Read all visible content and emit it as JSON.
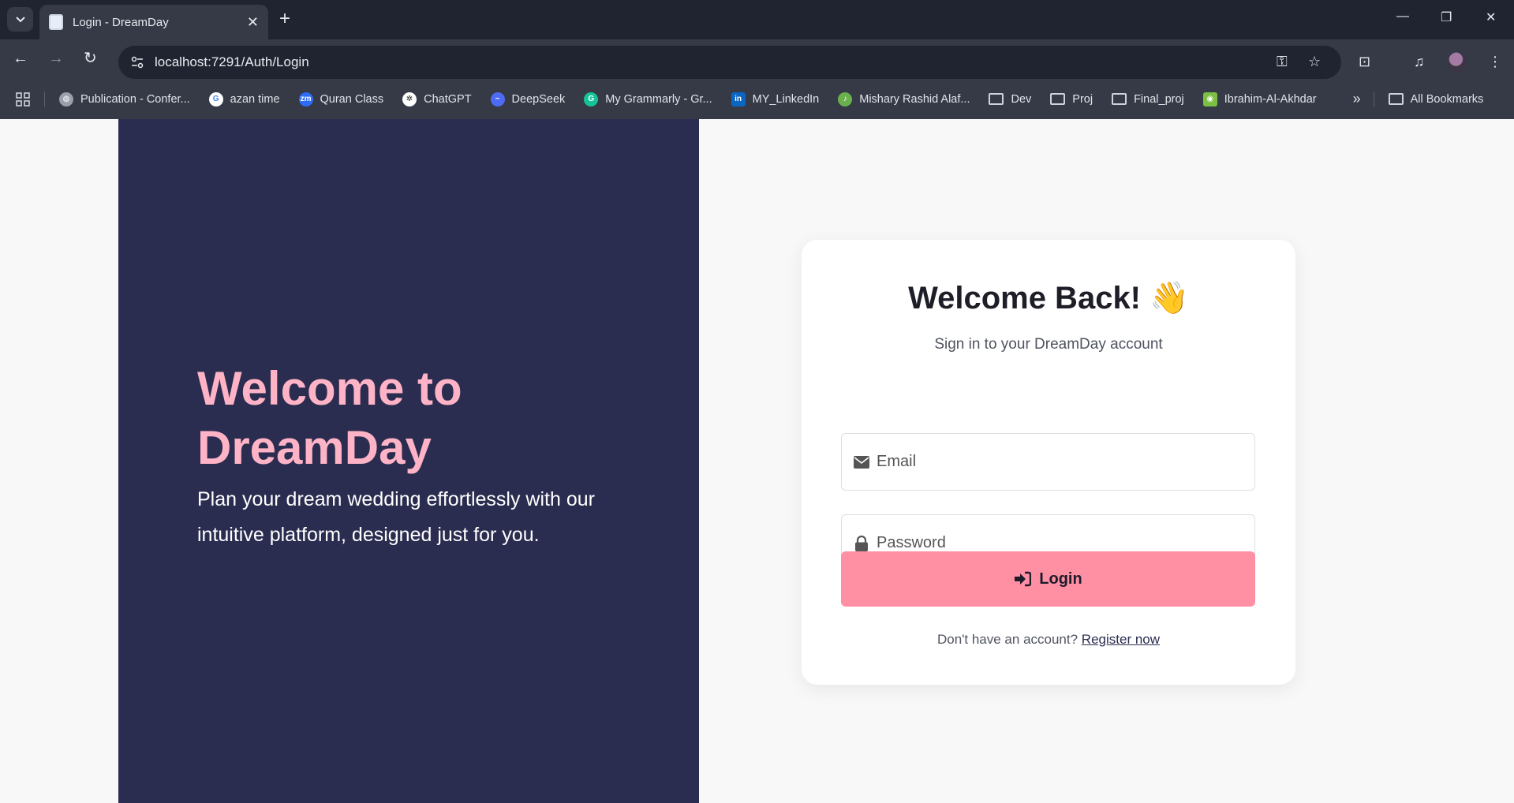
{
  "browser": {
    "tab_title": "Login - DreamDay",
    "url": "localhost:7291/Auth/Login",
    "bookmarks": [
      {
        "label": "Publication - Confer...",
        "icon": "globe-icon"
      },
      {
        "label": "azan time",
        "icon": "google-icon"
      },
      {
        "label": "Quran Class",
        "icon": "zoom-icon"
      },
      {
        "label": "ChatGPT",
        "icon": "chatgpt-icon"
      },
      {
        "label": "DeepSeek",
        "icon": "deepseek-icon"
      },
      {
        "label": "My Grammarly - Gr...",
        "icon": "grammarly-icon"
      },
      {
        "label": "MY_LinkedIn",
        "icon": "linkedin-icon"
      },
      {
        "label": "Mishary Rashid Alaf...",
        "icon": "site-icon"
      },
      {
        "label": "Dev",
        "icon": "folder-icon"
      },
      {
        "label": "Proj",
        "icon": "folder-icon"
      },
      {
        "label": "Final_proj",
        "icon": "folder-icon"
      },
      {
        "label": "Ibrahim-Al-Akhdar",
        "icon": "site-icon"
      }
    ],
    "all_bookmarks": "All Bookmarks",
    "overflow": "»"
  },
  "hero": {
    "title": "Welcome to DreamDay",
    "text": "Plan your dream wedding effortlessly with our intuitive platform, designed just for you."
  },
  "login": {
    "title": "Welcome Back! 👋",
    "subtitle": "Sign in to your DreamDay account",
    "email_placeholder": "Email",
    "password_placeholder": "Password",
    "button_label": "Login",
    "register_prompt": "Don't have an account?",
    "register_link": "Register now"
  },
  "colors": {
    "hero_bg": "#2b2d50",
    "hero_title": "#ffb3c6",
    "button": "#ff8fa3"
  }
}
